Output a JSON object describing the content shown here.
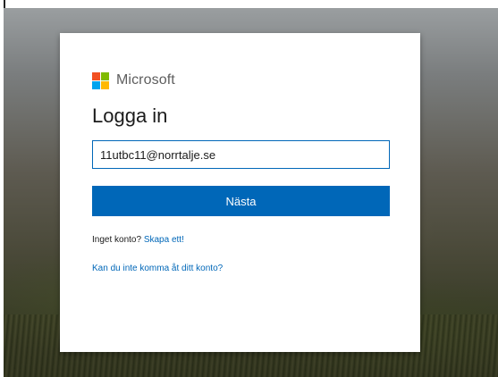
{
  "brand": {
    "name": "Microsoft",
    "logo_colors": [
      "#f25022",
      "#7fba00",
      "#00a4ef",
      "#ffb900"
    ]
  },
  "signin": {
    "title": "Logga in",
    "email_value": "11utbc11@norrtalje.se",
    "next_label": "Nästa",
    "no_account_text": "Inget konto?",
    "create_account_link": "Skapa ett!",
    "cant_access_link": "Kan du inte komma åt ditt konto?"
  },
  "colors": {
    "accent": "#0067b8"
  }
}
